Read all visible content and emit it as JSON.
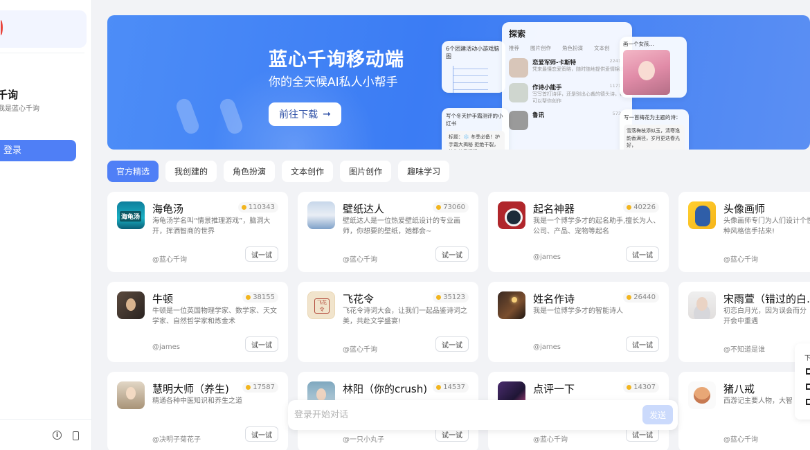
{
  "sidebar": {
    "title": "千询",
    "subtitle": "我是蓝心千询",
    "login_label": "登录",
    "icons": [
      "info-icon",
      "phone-icon"
    ]
  },
  "banner": {
    "title": "蓝心千询移动端",
    "subtitle": "你的全天候AI私人小帮手",
    "cta_label": "前往下载",
    "mockup": {
      "explore_title": "探索",
      "tabs": [
        "推荐",
        "图片创作",
        "角色扮演",
        "文本创"
      ],
      "mindmap_title": "6个团建活动小游戏脑图",
      "items": [
        {
          "name": "恋爱军师-卡斯特",
          "desc": "凭来最懂恋爱策略，随时随地提供爱情锦囊",
          "count": "2241"
        },
        {
          "name": "作诗小能手",
          "desc": "写写首打诗评，还是别出心裁的德头诗，都可以帮你创作",
          "count": "1171"
        },
        {
          "name": "鲁讯",
          "desc": "",
          "count": "573"
        }
      ],
      "note_title": "写个冬天护手霜测评的小红书",
      "note_text": "标题：❄️ 冬季必备！护手霜大揭秘 拒绝干裂，让你的手湿滑",
      "image_title": "画一个女孩…",
      "poem_title": "写一首梅花为主题的诗：",
      "poem_text": "雪落梅枝添似玉，清寒逸韵香满径，岁月更迭春光好，"
    }
  },
  "tabs": [
    {
      "label": "官方精选",
      "active": true
    },
    {
      "label": "我创建的",
      "active": false
    },
    {
      "label": "角色扮演",
      "active": false
    },
    {
      "label": "文本创作",
      "active": false
    },
    {
      "label": "图片创作",
      "active": false
    },
    {
      "label": "趣味学习",
      "active": false
    }
  ],
  "cards": [
    {
      "name": "海龟汤",
      "count": "110343",
      "desc": "海龟汤学名叫“情景推理游戏”，脑洞大开，挥洒智商的世界",
      "author": "@蓝心千询",
      "icon": "turtle-soup-icon",
      "icon_text": "海龟汤"
    },
    {
      "name": "壁纸达人",
      "count": "73060",
      "desc": "壁纸达人是一位热爱壁纸设计的专业画师，你想要的壁纸，她都会~",
      "author": "@蓝心千询",
      "icon": "wallpaper-icon"
    },
    {
      "name": "起名神器",
      "count": "40226",
      "desc": "我是一个博学多才的起名助手,擅长为人、公司、产品、宠物等起名",
      "author": "@james",
      "icon": "naming-icon"
    },
    {
      "name": "头像画师",
      "count": "",
      "desc": "头像画师专门为人们设计个性种风格信手拈来!",
      "author": "@蓝心千询",
      "icon": "avatar-painter-icon"
    },
    {
      "name": "牛顿",
      "count": "38155",
      "desc": "牛顿是一位英国物理学家、数学家、天文学家、自然哲学家和炼金术",
      "author": "@james",
      "icon": "newton-icon"
    },
    {
      "name": "飞花令",
      "count": "35123",
      "desc": "飞花令诗词大会，让我们一起品鉴诗词之美，共赴文学盛宴!",
      "author": "@蓝心千询",
      "icon": "feihualing-icon",
      "icon_text": "飞花令"
    },
    {
      "name": "姓名作诗",
      "count": "26440",
      "desc": "我是一位博学多才的智能诗人",
      "author": "@james",
      "icon": "name-poem-icon"
    },
    {
      "name": "宋雨萱（错过的白…",
      "count": "",
      "desc": "初恋白月光，因为误会而分开会中重遇",
      "author": "@不知道是谁",
      "icon": "song-yuxuan-icon"
    },
    {
      "name": "慧明大师（养生)",
      "count": "17587",
      "desc": "精通各种中医知识和养生之道",
      "author": "@决明子菊花子",
      "icon": "huiming-icon"
    },
    {
      "name": "林阳（你的crush)",
      "count": "14537",
      "desc": "",
      "author": "@一只小丸子",
      "icon": "linyang-icon"
    },
    {
      "name": "点评一下",
      "count": "14307",
      "desc": "",
      "author": "@蓝心千询",
      "icon": "review-icon"
    },
    {
      "name": "猪八戒",
      "count": "",
      "desc": "西游记主要人物，大智",
      "author": "@蓝心千询",
      "icon": "zhubajie-icon"
    }
  ],
  "try_label": "试一试",
  "chat": {
    "placeholder": "登录开始对话",
    "send_label": "发送"
  },
  "side_float": {
    "label": "下"
  }
}
